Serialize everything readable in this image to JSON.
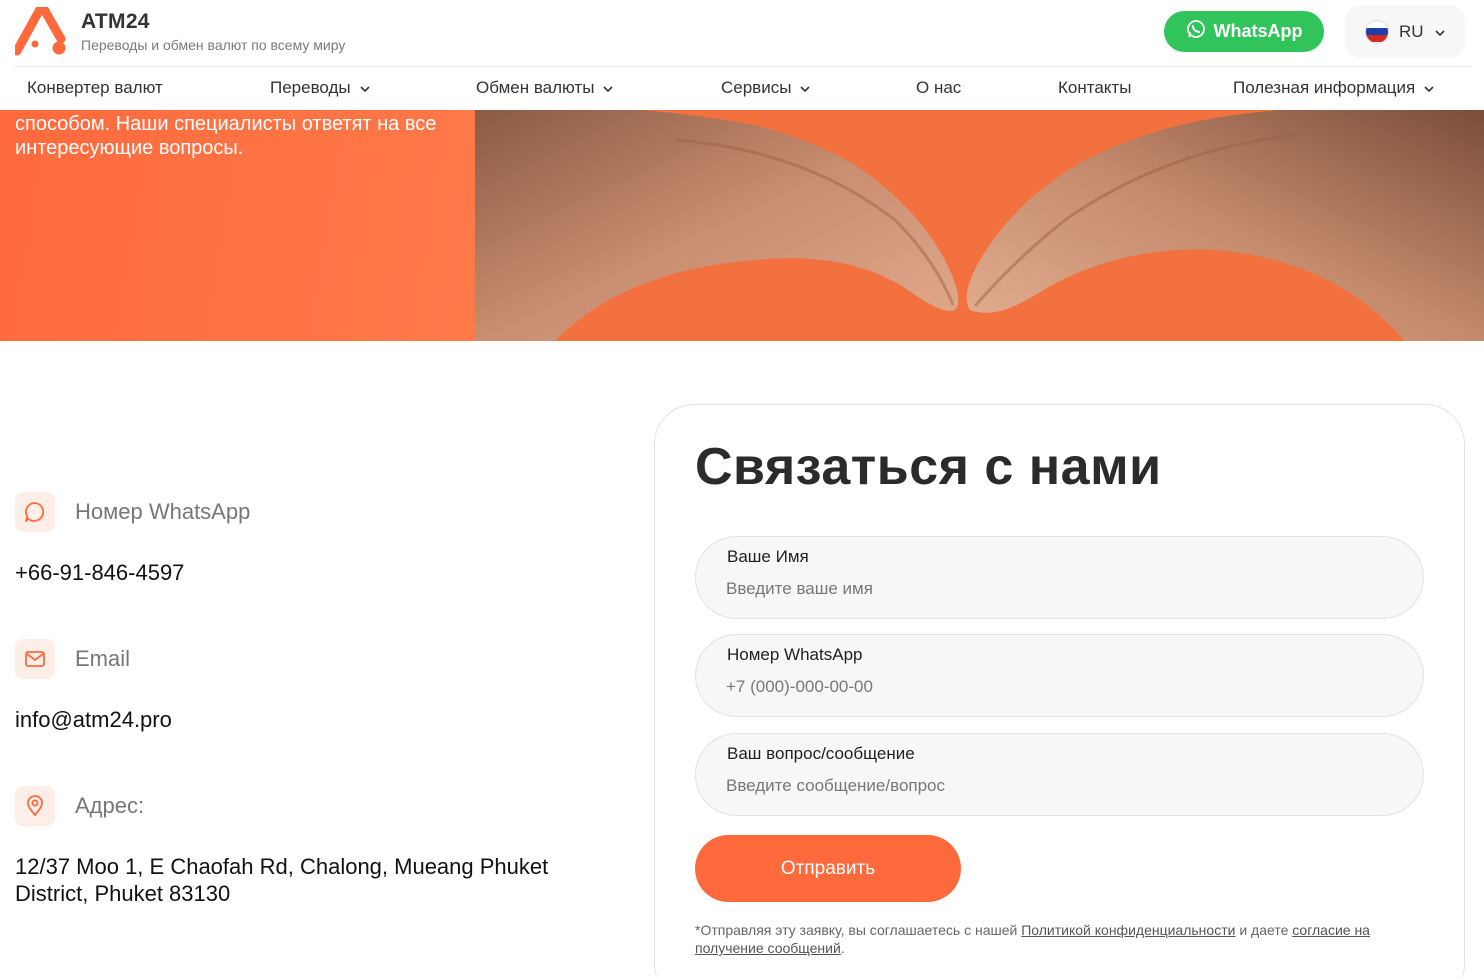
{
  "brand": {
    "name": "ATM24",
    "tagline": "Переводы и обмен валют по всему миру",
    "accent": "#ff6a3d"
  },
  "header": {
    "whatsapp_label": "WhatsApp",
    "language": "RU"
  },
  "nav": {
    "items": [
      {
        "label": "Конвертер валют",
        "dropdown": false
      },
      {
        "label": "Переводы",
        "dropdown": true
      },
      {
        "label": "Обмен валюты",
        "dropdown": true
      },
      {
        "label": "Сервисы",
        "dropdown": true
      },
      {
        "label": "О нас",
        "dropdown": false
      },
      {
        "label": "Контакты",
        "dropdown": false
      },
      {
        "label": "Полезная информация",
        "dropdown": true
      }
    ]
  },
  "hero": {
    "text_line1": "способом. Наши специалисты ответят на все",
    "text_line2": "интересующие вопросы."
  },
  "contacts": {
    "whatsapp": {
      "label": "Номер WhatsApp",
      "value": "+66-91-846-4597",
      "icon": "chat-icon"
    },
    "email": {
      "label": "Email",
      "value": "info@atm24.pro",
      "icon": "mail-icon"
    },
    "address": {
      "label": "Адрес:",
      "value": "12/37 Moo 1, E Chaofah Rd, Chalong, Mueang Phuket District, Phuket 83130",
      "icon": "location-pin-icon"
    }
  },
  "form": {
    "title": "Связаться с нами",
    "fields": [
      {
        "label": "Ваше Имя",
        "placeholder": "Введите ваше имя"
      },
      {
        "label": "Номер WhatsApp",
        "placeholder": "+7 (000)-000-00-00"
      },
      {
        "label": "Ваш вопрос/сообщение",
        "placeholder": "Введите сообщение/вопрос"
      }
    ],
    "submit": "Отправить",
    "consent_prefix": "*Отправляя эту заявку, вы соглашаетесь с нашей ",
    "consent_link1": "Политикой конфиденциальности",
    "consent_middle": " и даете ",
    "consent_link2": "согласие на получение сообщений",
    "consent_suffix": "."
  }
}
